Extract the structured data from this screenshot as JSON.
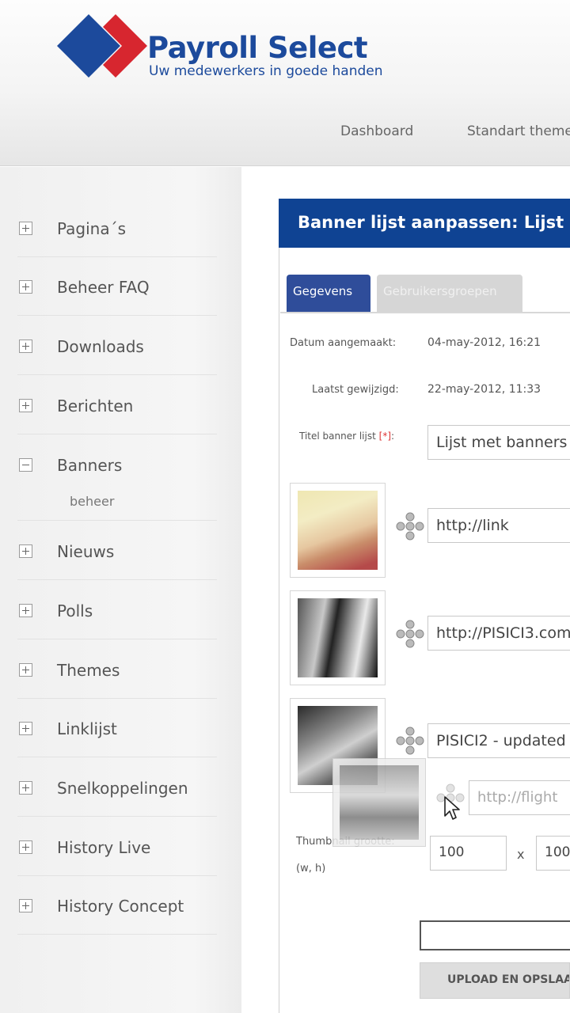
{
  "brand": {
    "title": "Payroll Select",
    "tagline": "Uw medewerkers in goede handen",
    "colors": {
      "blue": "#1c4a9c",
      "red": "#d7262f"
    }
  },
  "topnav": {
    "items": [
      {
        "label": "Dashboard"
      },
      {
        "label": "Standart theme"
      }
    ]
  },
  "sidebar": {
    "items": [
      {
        "label": "Pagina´s",
        "expanded": false
      },
      {
        "label": "Beheer FAQ",
        "expanded": false
      },
      {
        "label": "Downloads",
        "expanded": false
      },
      {
        "label": "Berichten",
        "expanded": false
      },
      {
        "label": "Banners",
        "expanded": true,
        "sub": "beheer"
      },
      {
        "label": "Nieuws",
        "expanded": false
      },
      {
        "label": "Polls",
        "expanded": false
      },
      {
        "label": "Themes",
        "expanded": false
      },
      {
        "label": "Linklijst",
        "expanded": false
      },
      {
        "label": "Snelkoppelingen",
        "expanded": false
      },
      {
        "label": "History Live",
        "expanded": false
      },
      {
        "label": "History Concept",
        "expanded": false
      }
    ]
  },
  "panel": {
    "title": "Banner lijst aanpassen:  Lijst",
    "header_color": "#0f4393",
    "tabs": [
      {
        "label": "Gegevens",
        "active": true
      },
      {
        "label": "Gebruikersgroepen",
        "active": false
      }
    ]
  },
  "form": {
    "created_label": "Datum aangemaakt:",
    "created_value": "04-may-2012, 16:21",
    "modified_label": "Laatst gewijzigd:",
    "modified_value": "22-may-2012, 11:33",
    "title_label": "Titel banner lijst",
    "required_mark": "[*]",
    "title_colon": ":",
    "title_value": "Lijst met banners",
    "banners": [
      {
        "link": "http://link",
        "thumb": "child-portrait"
      },
      {
        "link": "http://PISICI3.com",
        "thumb": "piano-keys"
      },
      {
        "link": "PISICI2 - updated",
        "thumb": "person-bw"
      }
    ],
    "new_link_placeholder": "http://flight",
    "thumb_size_label": "Thumbnail grootte:",
    "thumb_size_hint": "(w, h)",
    "thumb_width": "100",
    "thumb_times": "x",
    "thumb_height": "100",
    "upload_label": "UPLOAD EN OPSLAAN"
  }
}
